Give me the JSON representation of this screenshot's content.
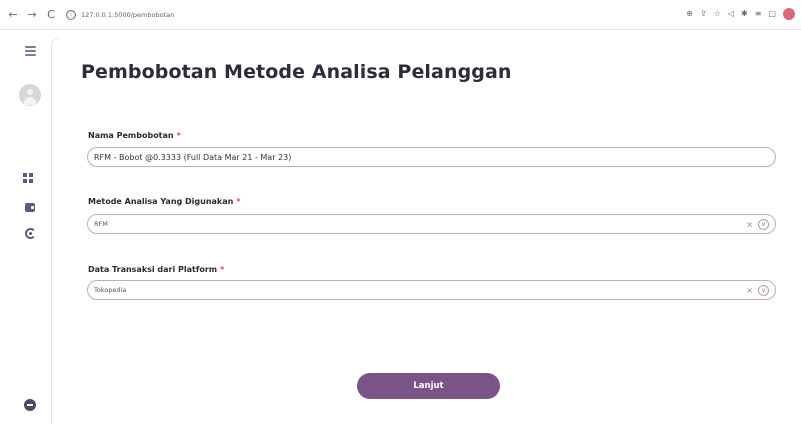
{
  "browser": {
    "url": "127.0.0.1:5000/pembobotan",
    "nav_back": "←",
    "nav_forward": "→",
    "nav_reload": "C",
    "info": "ⓘ",
    "toolbar_icons": [
      "⊕",
      "⇪",
      "☆",
      "◁",
      "✱",
      "≡",
      "▢"
    ]
  },
  "main": {
    "title": "Pembobotan Metode Analisa Pelanggan",
    "fields": {
      "nama": {
        "label": "Nama Pembobotan",
        "required": "*",
        "value": "RFM - Bobot @0.3333 (Full Data Mar 21 - Mar 23)"
      },
      "metode": {
        "label": "Metode Analisa Yang Digunakan",
        "required": "*",
        "value": "RFM",
        "clear": "×",
        "chevron": "v"
      },
      "platform": {
        "label": "Data Transaksi dari Platform",
        "required": "*",
        "value": "Tokopedia",
        "clear": "×",
        "chevron": "v"
      }
    },
    "submit_label": "Lanjut"
  },
  "colors": {
    "accent": "#7a5487",
    "input_border": "#c9a8c9",
    "required": "#d4496b"
  }
}
